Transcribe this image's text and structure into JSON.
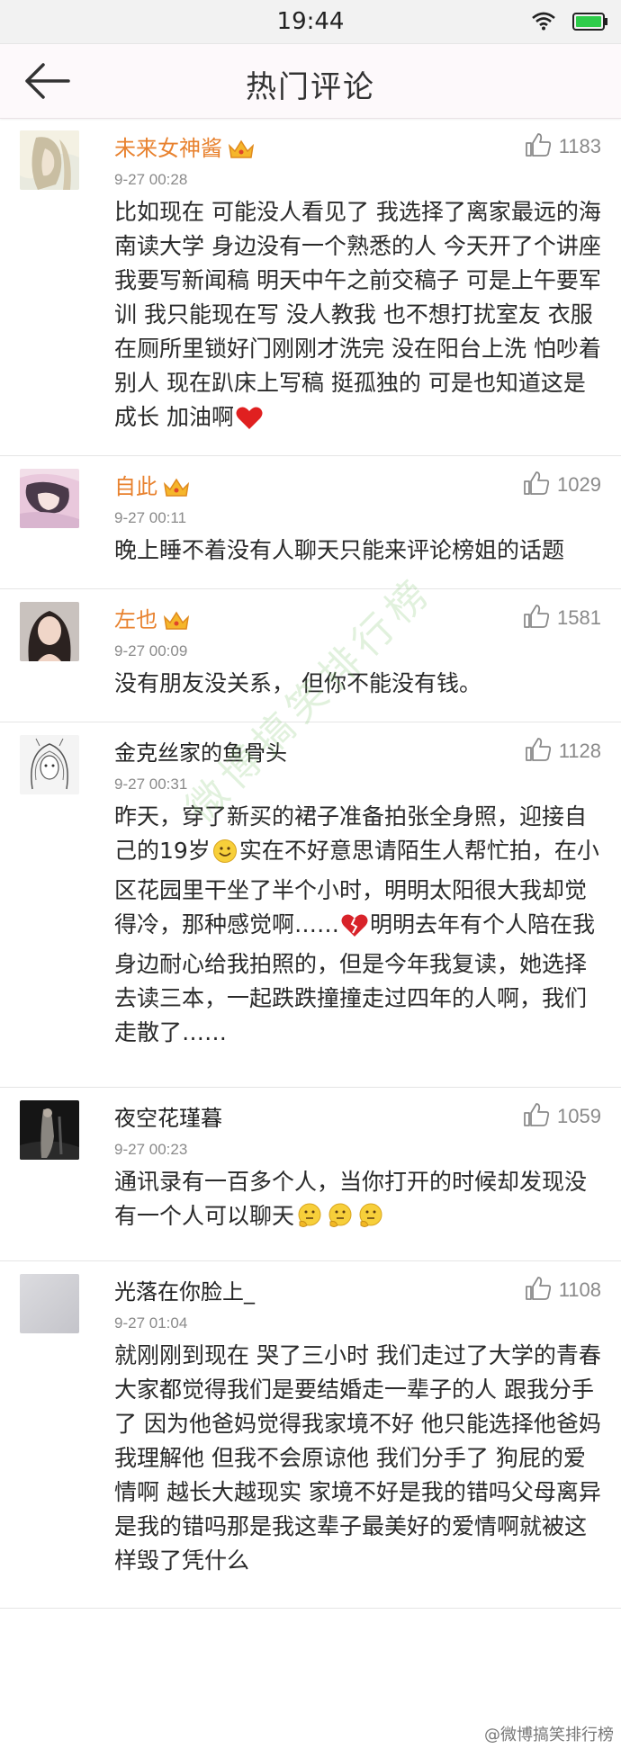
{
  "status_bar": {
    "time": "19:44"
  },
  "header": {
    "title": "热门评论"
  },
  "comments": [
    {
      "username": "未来女神酱",
      "vip": true,
      "time": "9-27 00:28",
      "likes": "1183",
      "text": "比如现在 可能没人看见了 我选择了离家最远的海南读大学 身边没有一个熟悉的人 今天开了个讲座 我要写新闻稿 明天中午之前交稿子 可是上午要军训 我只能现在写 没人教我 也不想打扰室友 衣服在厕所里锁好门刚刚才洗完 没在阳台上洗 怕吵着别人 现在趴床上写稿 挺孤独的 可是也知道这是成长 加油啊"
    },
    {
      "username": "自此",
      "vip": true,
      "time": "9-27 00:11",
      "likes": "1029",
      "text": "晚上睡不着没有人聊天只能来评论榜姐的话题"
    },
    {
      "username": "左也",
      "vip": true,
      "time": "9-27 00:09",
      "likes": "1581",
      "text": "没有朋友没关系， 但你不能没有钱。"
    },
    {
      "username": "金克丝家的鱼骨头",
      "vip": false,
      "time": "9-27 00:31",
      "likes": "1128",
      "text_parts": [
        "昨天，穿了新买的裙子准备拍张全身照，迎接自己的19岁",
        "实在不好意思请陌生人帮忙拍，在小区花园里干坐了半个小时，明明太阳很大我却觉得冷，那种感觉啊……",
        "明明去年有个人陪在我身边耐心给我拍照的，但是今年我复读，她选择去读三本，一起跌跌撞撞走过四年的人啊，我们走散了……"
      ]
    },
    {
      "username": "夜空花瑾暮",
      "vip": false,
      "time": "9-27 00:23",
      "likes": "1059",
      "text": "通讯录有一百多个人，当你打开的时候却发现没有一个人可以聊天"
    },
    {
      "username": "光落在你脸上_",
      "vip": false,
      "time": "9-27 01:04",
      "likes": "1108",
      "text": "就刚刚到现在 哭了三小时 我们走过了大学的青春 大家都觉得我们是要结婚走一辈子的人 跟我分手了 因为他爸妈觉得我家境不好 他只能选择他爸妈 我理解他 但我不会原谅他 我们分手了 狗屁的爱情啊 越长大越现实 家境不好是我的错吗父母离异是我的错吗那是我这辈子最美好的爱情啊就被这样毁了凭什么"
    }
  ],
  "watermark": "微博搞笑排行榜",
  "signature": "@微博搞笑排行榜",
  "colors": {
    "vip_name": "#e8822f",
    "battery": "#2ecc4a",
    "heart": "#e02020"
  },
  "icons": [
    "back-arrow-icon",
    "wifi-icon",
    "battery-icon",
    "thumbs-up-icon",
    "crown-icon",
    "heart-emoji",
    "smile-emoji",
    "broken-heart-emoji",
    "thinking-emoji"
  ]
}
